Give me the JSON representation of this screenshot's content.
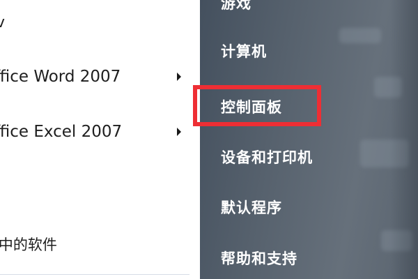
{
  "programs": [
    {
      "label": "ffice Word 2007",
      "has_submenu": true
    },
    {
      "label": "ffice Excel 2007",
      "has_submenu": true
    },
    {
      "label": "i中的软件",
      "has_submenu": false
    }
  ],
  "top_fragment": "v",
  "right_menu": [
    {
      "label": "游戏"
    },
    {
      "label": "计算机"
    },
    {
      "label": "控制面板"
    },
    {
      "label": "设备和打印机"
    },
    {
      "label": "默认程序"
    },
    {
      "label": "帮助和支持"
    }
  ],
  "colors": {
    "highlight": "#ee2e34",
    "right_pane": "#56616d",
    "left_pane": "#ffffff"
  }
}
